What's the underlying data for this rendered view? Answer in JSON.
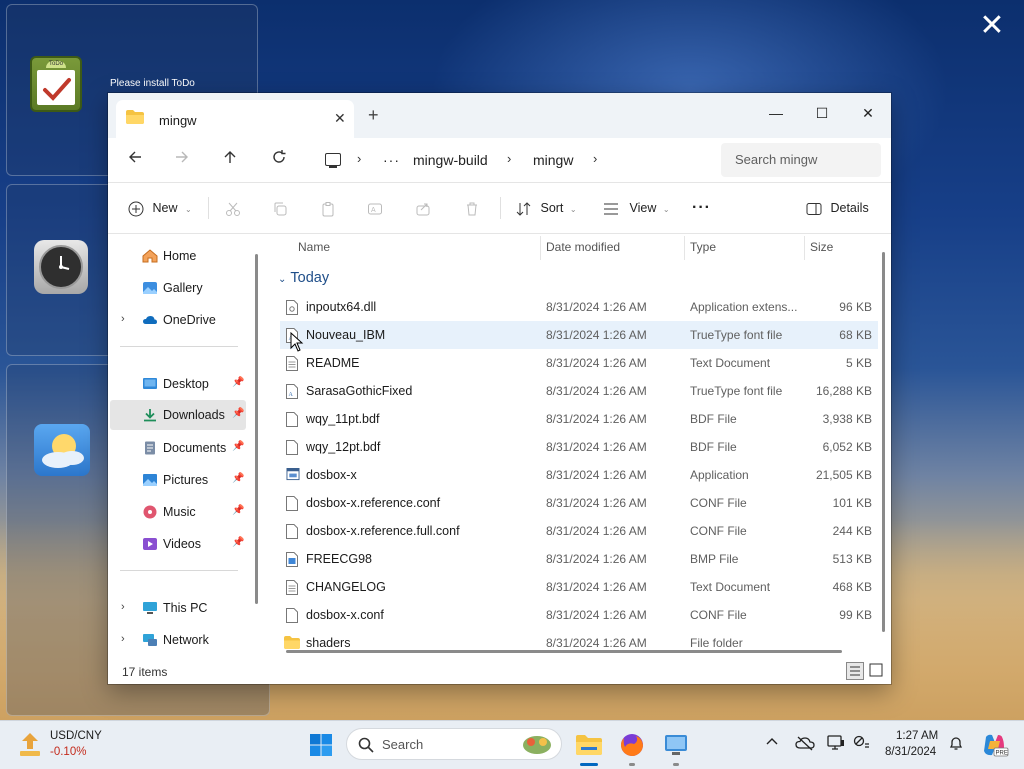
{
  "desktop": {
    "todo_widget_message": "Please install ToDo",
    "todo_icon_label": "ToDo",
    "close_overlay": "✕"
  },
  "window": {
    "tab_title": "mingw",
    "new_tab": "+",
    "controls": {
      "minimize": "—",
      "maximize": "☐",
      "close": "✕"
    }
  },
  "address": {
    "breadcrumbs": [
      "mingw-build",
      "mingw"
    ],
    "overflow": "···",
    "search_placeholder": "Search mingw"
  },
  "toolbar": {
    "new_label": "New",
    "sort_label": "Sort",
    "view_label": "View",
    "more_label": "···",
    "details_label": "Details"
  },
  "nav": {
    "items": [
      {
        "label": "Home",
        "icon": "home-icon"
      },
      {
        "label": "Gallery",
        "icon": "gallery-icon"
      },
      {
        "label": "OneDrive",
        "icon": "cloud-icon"
      },
      {
        "label": "Desktop",
        "icon": "desktop-icon"
      },
      {
        "label": "Downloads",
        "icon": "download-icon"
      },
      {
        "label": "Documents",
        "icon": "documents-icon"
      },
      {
        "label": "Pictures",
        "icon": "pictures-icon"
      },
      {
        "label": "Music",
        "icon": "music-icon"
      },
      {
        "label": "Videos",
        "icon": "videos-icon"
      },
      {
        "label": "This PC",
        "icon": "pc-icon"
      },
      {
        "label": "Network",
        "icon": "network-icon"
      }
    ]
  },
  "list": {
    "columns": {
      "name": "Name",
      "date": "Date modified",
      "type": "Type",
      "size": "Size"
    },
    "group": "Today",
    "files": [
      {
        "name": "inpoutx64.dll",
        "date": "8/31/2024 1:26 AM",
        "type": "Application extens...",
        "size": "96 KB",
        "icon": "dll-icon"
      },
      {
        "name": "Nouveau_IBM",
        "date": "8/31/2024 1:26 AM",
        "type": "TrueType font file",
        "size": "68 KB",
        "icon": "font-icon"
      },
      {
        "name": "README",
        "date": "8/31/2024 1:26 AM",
        "type": "Text Document",
        "size": "5 KB",
        "icon": "text-icon"
      },
      {
        "name": "SarasaGothicFixed",
        "date": "8/31/2024 1:26 AM",
        "type": "TrueType font file",
        "size": "16,288 KB",
        "icon": "font-icon"
      },
      {
        "name": "wqy_11pt.bdf",
        "date": "8/31/2024 1:26 AM",
        "type": "BDF File",
        "size": "3,938 KB",
        "icon": "file-icon"
      },
      {
        "name": "wqy_12pt.bdf",
        "date": "8/31/2024 1:26 AM",
        "type": "BDF File",
        "size": "6,052 KB",
        "icon": "file-icon"
      },
      {
        "name": "dosbox-x",
        "date": "8/31/2024 1:26 AM",
        "type": "Application",
        "size": "21,505 KB",
        "icon": "app-icon"
      },
      {
        "name": "dosbox-x.reference.conf",
        "date": "8/31/2024 1:26 AM",
        "type": "CONF File",
        "size": "101 KB",
        "icon": "file-icon"
      },
      {
        "name": "dosbox-x.reference.full.conf",
        "date": "8/31/2024 1:26 AM",
        "type": "CONF File",
        "size": "244 KB",
        "icon": "file-icon"
      },
      {
        "name": "FREECG98",
        "date": "8/31/2024 1:26 AM",
        "type": "BMP File",
        "size": "513 KB",
        "icon": "image-icon"
      },
      {
        "name": "CHANGELOG",
        "date": "8/31/2024 1:26 AM",
        "type": "Text Document",
        "size": "468 KB",
        "icon": "text-icon"
      },
      {
        "name": "dosbox-x.conf",
        "date": "8/31/2024 1:26 AM",
        "type": "CONF File",
        "size": "99 KB",
        "icon": "file-icon"
      },
      {
        "name": "shaders",
        "date": "8/31/2024 1:26 AM",
        "type": "File folder",
        "size": "",
        "icon": "folder-icon"
      }
    ]
  },
  "status": {
    "items_count": "17 items"
  },
  "taskbar": {
    "ticker_symbol": "USD/CNY",
    "ticker_change": "-0.10%",
    "search_label": "Search",
    "time": "1:27 AM",
    "date": "8/31/2024"
  },
  "colors": {
    "accent": "#0067c0",
    "group_header": "#1f4e89",
    "ticker_negative": "#c42b1c",
    "selected_nav": "#e5e5e5",
    "hover_row": "#e7f1fb"
  }
}
